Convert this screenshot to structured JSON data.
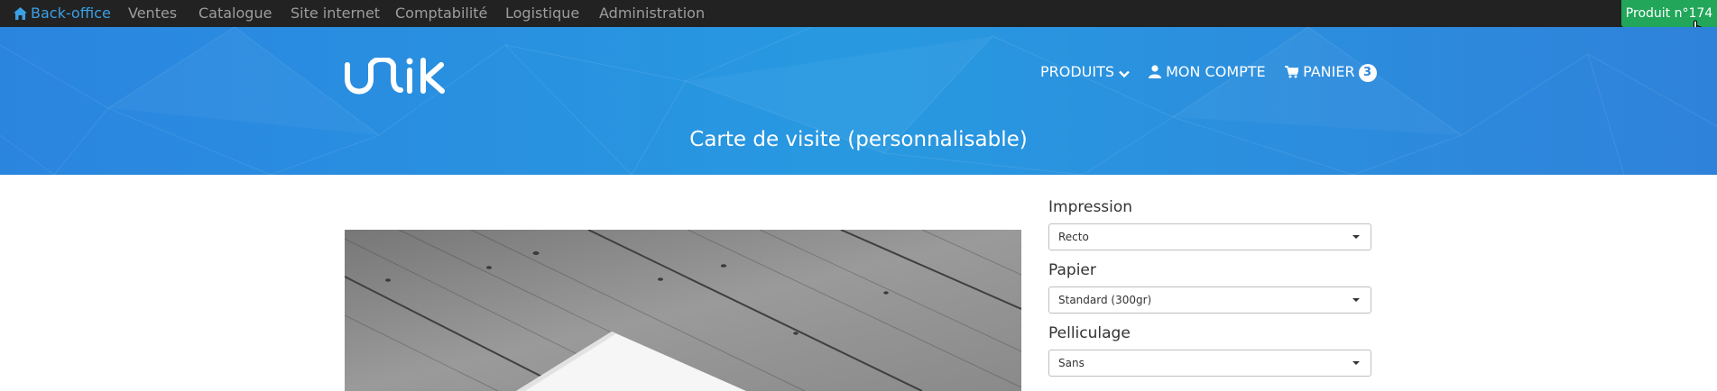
{
  "adminbar": {
    "items": [
      {
        "label": "Back-office",
        "icon": "home-icon",
        "active": true
      },
      {
        "label": "Ventes"
      },
      {
        "label": "Catalogue"
      },
      {
        "label": "Site internet"
      },
      {
        "label": "Comptabilité"
      },
      {
        "label": "Logistique"
      },
      {
        "label": "Administration"
      }
    ],
    "product_badge": "Produit n°174"
  },
  "header": {
    "logo": "unik",
    "nav": {
      "products": "PRODUITS",
      "account": "MON COMPTE",
      "cart": "PANIER",
      "cart_count": "3"
    },
    "page_title": "Carte de visite (personnalisable)"
  },
  "options": [
    {
      "label": "Impression",
      "value": "Recto"
    },
    {
      "label": "Papier",
      "value": "Standard (300gr)"
    },
    {
      "label": "Pelliculage",
      "value": "Sans"
    }
  ],
  "colors": {
    "adminbar_bg": "#222222",
    "active_link": "#3aa0e6",
    "badge_green": "#21a65a",
    "hero_blue": "#2899e1"
  }
}
